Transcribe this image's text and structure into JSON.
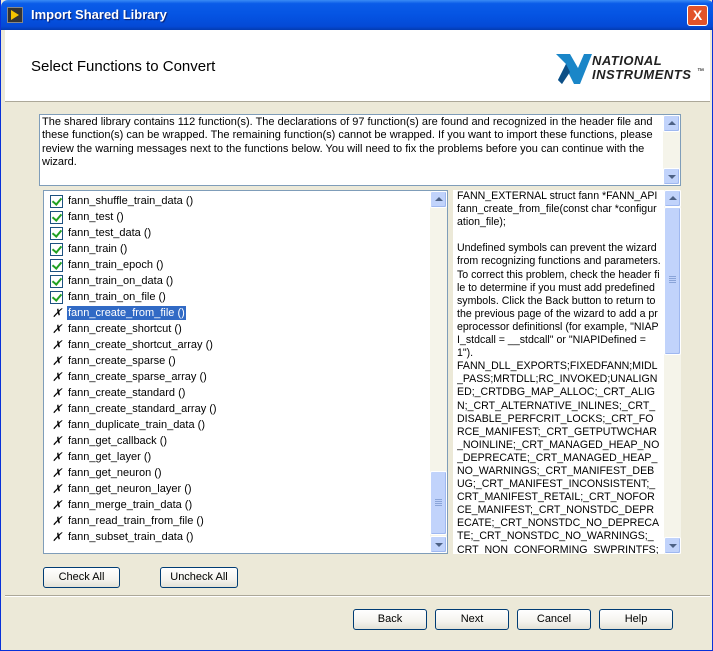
{
  "window": {
    "title": "Import Shared Library",
    "close_symbol": "X"
  },
  "header": {
    "page_title": "Select Functions to Convert",
    "logo_line1": "NATIONAL",
    "logo_line2": "INSTRUMENTS",
    "logo_mark": "™"
  },
  "description": "The shared library contains 112 function(s). The declarations of 97 function(s) are found and recognized in the header file and these function(s) can be wrapped. The remaining function(s) cannot be wrapped. If you want to import these functions, please review the warning messages next to the functions below. You will need to fix the problems before you can continue with the wizard.",
  "functions": [
    {
      "label": "fann_shuffle_train_data ()",
      "status": "ok"
    },
    {
      "label": "fann_test ()",
      "status": "ok"
    },
    {
      "label": "fann_test_data ()",
      "status": "ok"
    },
    {
      "label": "fann_train ()",
      "status": "ok"
    },
    {
      "label": "fann_train_epoch ()",
      "status": "ok"
    },
    {
      "label": "fann_train_on_data ()",
      "status": "ok"
    },
    {
      "label": "fann_train_on_file ()",
      "status": "ok"
    },
    {
      "label": "fann_create_from_file ()",
      "status": "error",
      "selected": true
    },
    {
      "label": "fann_create_shortcut ()",
      "status": "error"
    },
    {
      "label": "fann_create_shortcut_array ()",
      "status": "error"
    },
    {
      "label": "fann_create_sparse ()",
      "status": "error"
    },
    {
      "label": "fann_create_sparse_array ()",
      "status": "error"
    },
    {
      "label": "fann_create_standard ()",
      "status": "error"
    },
    {
      "label": "fann_create_standard_array ()",
      "status": "error"
    },
    {
      "label": "fann_duplicate_train_data ()",
      "status": "error"
    },
    {
      "label": "fann_get_callback ()",
      "status": "error"
    },
    {
      "label": "fann_get_layer ()",
      "status": "error"
    },
    {
      "label": "fann_get_neuron ()",
      "status": "error"
    },
    {
      "label": "fann_get_neuron_layer ()",
      "status": "error"
    },
    {
      "label": "fann_merge_train_data ()",
      "status": "error"
    },
    {
      "label": "fann_read_train_from_file ()",
      "status": "error"
    },
    {
      "label": "fann_subset_train_data ()",
      "status": "error"
    }
  ],
  "info": "FANN_EXTERNAL struct fann *FANN_API fann_create_from_file(const char *configuration_file);\n\nUndefined symbols can prevent the wizard from recognizing functions and parameters. To correct this problem, check the header file to determine if you must add predefined symbols. Click the Back button to return to the previous page of the wizard to add a preprocessor definitionsl (for example, \"NIAPI_stdcall = __stdcall\" or \"NIAPIDefined = 1\").\nFANN_DLL_EXPORTS;FIXEDFANN;MIDL_PASS;MRTDLL;RC_INVOKED;UNALIGNED;_CRTDBG_MAP_ALLOC;_CRT_ALIGN;_CRT_ALTERNATIVE_INLINES;_CRT_DISABLE_PERFCRIT_LOCKS;_CRT_FORCE_MANIFEST;_CRT_GETPUTWCHAR_NOINLINE;_CRT_MANAGED_HEAP_NO_DEPRECATE;_CRT_MANAGED_HEAP_NO_WARNINGS;_CRT_MANIFEST_DEBUG;_CRT_MANIFEST_INCONSISTENT;_CRT_MANIFEST_RETAIL;_CRT_NOFORCE_MANIFEST;_CRT_NONSTDC_DEPRECATE;_CRT_NONSTDC_NO_DEPRECATE;_CRT_NONSTDC_NO_WARNINGS;_CRT_NON_CONFORMING_SWPRINTFS;_CRT_OBSOLETE_NO_DEPRECATE;_",
  "buttons": {
    "check_all": "Check All",
    "uncheck_all": "Uncheck All",
    "back": "Back",
    "next": "Next",
    "cancel": "Cancel",
    "help": "Help"
  }
}
